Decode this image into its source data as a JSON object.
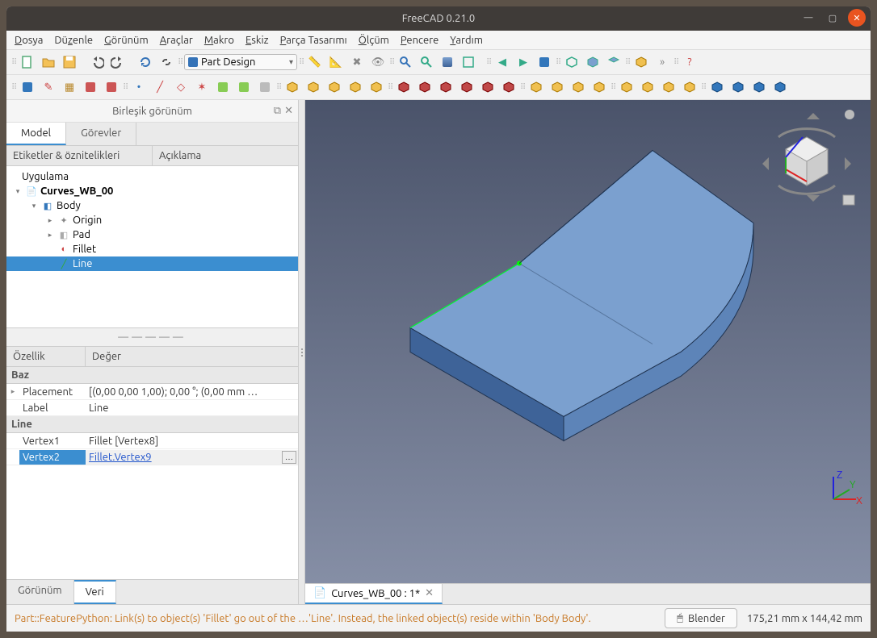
{
  "title": "FreeCAD 0.21.0",
  "menu": [
    "Dosya",
    "Düzenle",
    "Görünüm",
    "Araçlar",
    "Makro",
    "Eskiz",
    "Parça Tasarımı",
    "Ölçüm",
    "Pencere",
    "Yardım"
  ],
  "workbench": "Part Design",
  "panel": {
    "title": "Birleşik görünüm",
    "tabs": {
      "model": "Model",
      "tasks": "Görevler"
    },
    "treeHeaders": {
      "labels": "Etiketler & öznitelikleri",
      "desc": "Açıklama"
    },
    "appLabel": "Uygulama",
    "treeItems": {
      "doc": "Curves_WB_00",
      "body": "Body",
      "origin": "Origin",
      "pad": "Pad",
      "fillet": "Fillet",
      "line": "Line"
    },
    "propHeaders": {
      "prop": "Özellik",
      "val": "Değer"
    },
    "groups": {
      "base": "Baz",
      "line": "Line"
    },
    "props": {
      "placement": {
        "name": "Placement",
        "val": "[(0,00 0,00 1,00); 0,00 °; (0,00 mm  …"
      },
      "label": {
        "name": "Label",
        "val": "Line"
      },
      "v1": {
        "name": "Vertex1",
        "val": "Fillet [Vertex8]"
      },
      "v2": {
        "name": "Vertex2",
        "val": "Fillet.Vertex9"
      }
    },
    "bottomTabs": {
      "view": "Görünüm",
      "data": "Veri"
    }
  },
  "docTab": "Curves_WB_00 : 1*",
  "status": {
    "msg": "Part::FeaturePython: Link(s) to object(s) 'Fillet' go out of the …'Line'. Instead, the linked object(s) reside within 'Body Body'.",
    "nav": "Blender",
    "coords": "175,21 mm x 144,42 mm"
  }
}
